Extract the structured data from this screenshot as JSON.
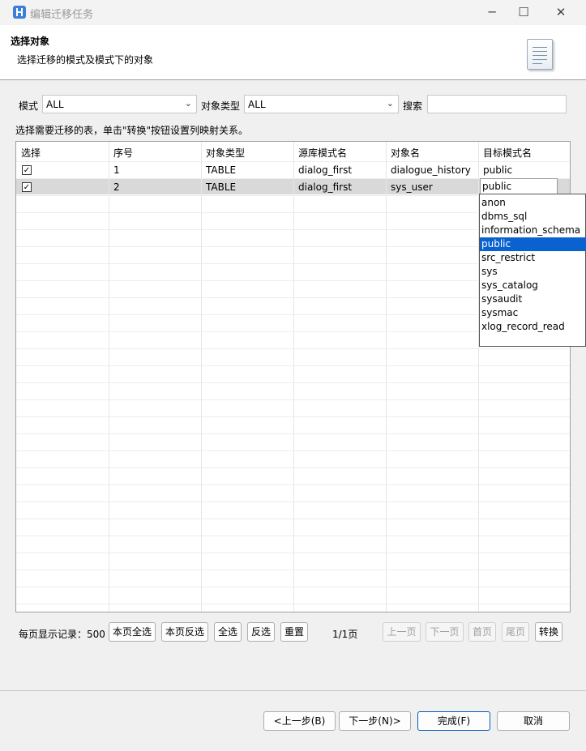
{
  "window": {
    "title": "编辑迁移任务",
    "minimize": "─",
    "maximize": "☐",
    "close": "✕"
  },
  "header": {
    "title": "选择对象",
    "subtitle": "选择迁移的模式及模式下的对象"
  },
  "filters": {
    "schema_label": "模式",
    "schema_value": "ALL",
    "type_label": "对象类型",
    "type_value": "ALL",
    "search_label": "搜索",
    "search_value": ""
  },
  "instruction": "选择需要迁移的表，单击\"转换\"按钮设置列映射关系。",
  "table": {
    "columns": [
      "选择",
      "序号",
      "对象类型",
      "源库模式名",
      "对象名",
      "目标模式名"
    ],
    "rows": [
      {
        "selected": true,
        "index": "1",
        "type": "TABLE",
        "source_schema": "dialog_first",
        "object": "dialogue_history",
        "target": "public"
      },
      {
        "selected": true,
        "index": "2",
        "type": "TABLE",
        "source_schema": "dialog_first",
        "object": "sys_user",
        "target": "public"
      }
    ]
  },
  "dropdown": {
    "options": [
      "anon",
      "dbms_sql",
      "information_schema",
      "public",
      "src_restrict",
      "sys",
      "sys_catalog",
      "sysaudit",
      "sysmac",
      "xlog_record_read"
    ],
    "selected": "public"
  },
  "pager": {
    "records_label": "每页显示记录：500",
    "select_page": "本页全选",
    "invert_page": "本页反选",
    "select_all": "全选",
    "invert": "反选",
    "reset": "重置",
    "page_info": "1/1页",
    "prev": "上一页",
    "next": "下一页",
    "first": "首页",
    "last": "尾页",
    "convert": "转换"
  },
  "footer": {
    "back": "<上一步(B)",
    "next": "下一步(N)>",
    "finish": "完成(F)",
    "cancel": "取消"
  }
}
